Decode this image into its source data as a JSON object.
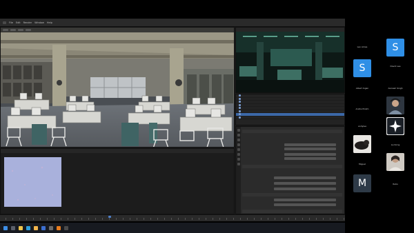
{
  "colors": {
    "accent_blue": "#2f8fe6",
    "avatar_grey": "#2e3a47",
    "background": "#000000"
  },
  "blender": {
    "topbar_items": [
      "File",
      "Edit",
      "Render",
      "Window",
      "Help"
    ],
    "outliner_rows": [
      "",
      "",
      "",
      "",
      "",
      "",
      "",
      ""
    ],
    "outliner_active_index": 6,
    "properties_sections": [
      "",
      "",
      "",
      ""
    ]
  },
  "taskbar": {
    "icons": [
      "windows-icon",
      "search-icon",
      "files-icon",
      "edge-icon",
      "explorer-icon",
      "mail-icon",
      "store-icon",
      "blender-icon",
      "app-icon"
    ]
  },
  "participants": [
    {
      "name": "Leo Ames",
      "avatar": "",
      "type": "none"
    },
    {
      "name": "",
      "avatar": "S",
      "type": "letter",
      "color": "#2f8fe6"
    },
    {
      "name": "",
      "avatar": "S",
      "type": "letter",
      "color": "#2f8fe6"
    },
    {
      "name": "David Lee",
      "avatar": "",
      "type": "none"
    },
    {
      "name": "Albert Ingan",
      "avatar": "",
      "type": "none"
    },
    {
      "name": "Avinash Singh",
      "avatar": "",
      "type": "none"
    },
    {
      "name": "Andre Pinkm",
      "avatar": "",
      "type": "none"
    },
    {
      "name": "",
      "avatar": "",
      "type": "photo-person"
    },
    {
      "name": "andylee",
      "avatar": "",
      "type": "none"
    },
    {
      "name": "",
      "avatar": "",
      "type": "star"
    },
    {
      "name": "",
      "avatar": "",
      "type": "photo-cat"
    },
    {
      "name": "Lucbcng",
      "avatar": "",
      "type": "none"
    },
    {
      "name": "Miguel",
      "avatar": "",
      "type": "none"
    },
    {
      "name": "",
      "avatar": "",
      "type": "photo-person2"
    },
    {
      "name": "",
      "avatar": "M",
      "type": "letter",
      "color": "#2e3a47"
    },
    {
      "name": "Rubs",
      "avatar": "",
      "type": "none"
    }
  ]
}
